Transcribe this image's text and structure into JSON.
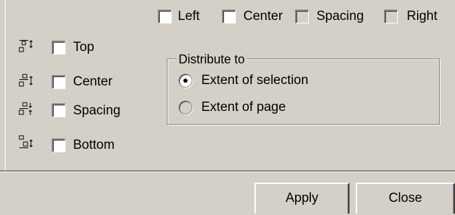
{
  "horizontal": {
    "left_label": "Left",
    "center_label": "Center",
    "spacing_label": "Spacing",
    "right_label": "Right"
  },
  "vertical": {
    "top_label": "Top",
    "center_label": "Center",
    "spacing_label": "Spacing",
    "bottom_label": "Bottom"
  },
  "distribute": {
    "title": "Distribute to",
    "selection_label": "Extent of selection",
    "page_label": "Extent of page",
    "selected": "selection"
  },
  "buttons": {
    "apply_label": "Apply",
    "close_label": "Close"
  }
}
